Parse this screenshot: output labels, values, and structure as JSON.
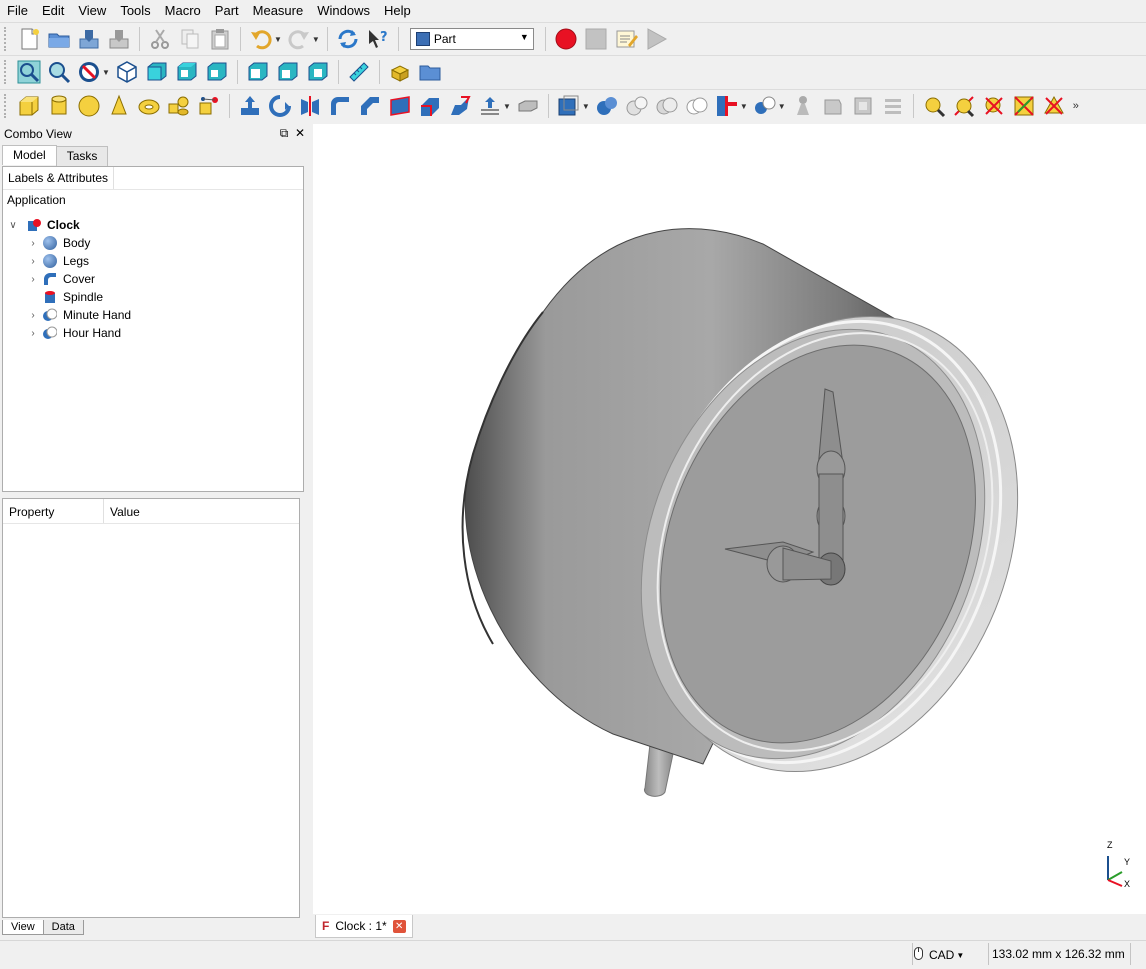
{
  "menu": [
    "File",
    "Edit",
    "View",
    "Tools",
    "Macro",
    "Part",
    "Measure",
    "Windows",
    "Help"
  ],
  "workbench": {
    "selected": "Part"
  },
  "combo": {
    "title": "Combo View",
    "tabs": [
      "Model",
      "Tasks"
    ],
    "tree_header": "Labels & Attributes",
    "application_label": "Application",
    "root": "Clock",
    "items": [
      "Body",
      "Legs",
      "Cover",
      "Spindle",
      "Minute Hand",
      "Hour Hand"
    ],
    "property_header": "Property",
    "value_header": "Value",
    "bottom_tabs": [
      "View",
      "Data"
    ]
  },
  "document_tab": {
    "label": "Clock : 1*"
  },
  "status": {
    "nav_style": "CAD",
    "dimensions": "133.02 mm x 126.32 mm"
  },
  "axes": {
    "z": "Z",
    "y": "Y",
    "x": "X"
  },
  "colors": {
    "record": "#e81123",
    "accent": "#3c6fb5"
  }
}
